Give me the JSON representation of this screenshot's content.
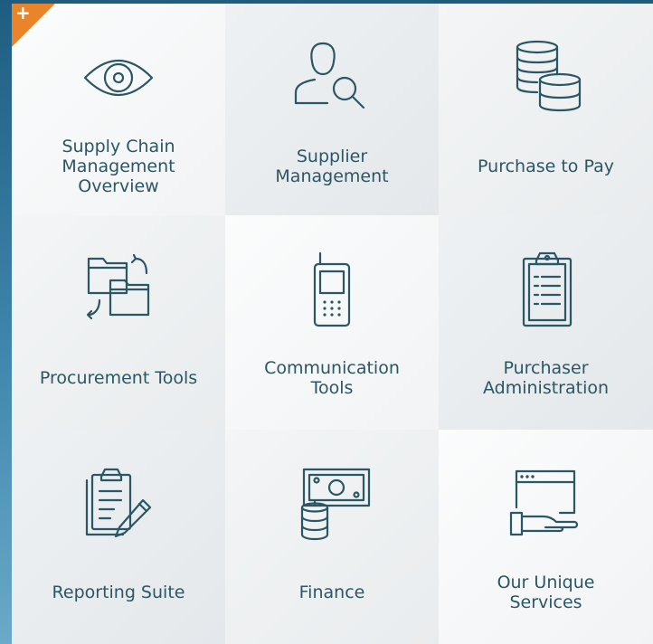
{
  "tiles": [
    {
      "label": "Supply Chain\nManagement\nOverview",
      "icon": "eye-icon"
    },
    {
      "label": "Supplier\nManagement",
      "icon": "person-search-icon"
    },
    {
      "label": "Purchase to Pay",
      "icon": "coin-stacks-icon"
    },
    {
      "label": "Procurement Tools",
      "icon": "folders-exchange-icon"
    },
    {
      "label": "Communication\nTools",
      "icon": "mobile-phone-icon"
    },
    {
      "label": "Purchaser\nAdministration",
      "icon": "clipboard-list-icon"
    },
    {
      "label": "Reporting Suite",
      "icon": "clipboard-pencil-icon"
    },
    {
      "label": "Finance",
      "icon": "money-coins-icon"
    },
    {
      "label": "Our Unique\nServices",
      "icon": "browser-hand-icon"
    }
  ],
  "corner_badge": {
    "symbol": "+",
    "color": "#e98528"
  },
  "colors": {
    "icon_stroke": "#2b5663",
    "text": "#2b5663",
    "background": "#2f739a"
  }
}
